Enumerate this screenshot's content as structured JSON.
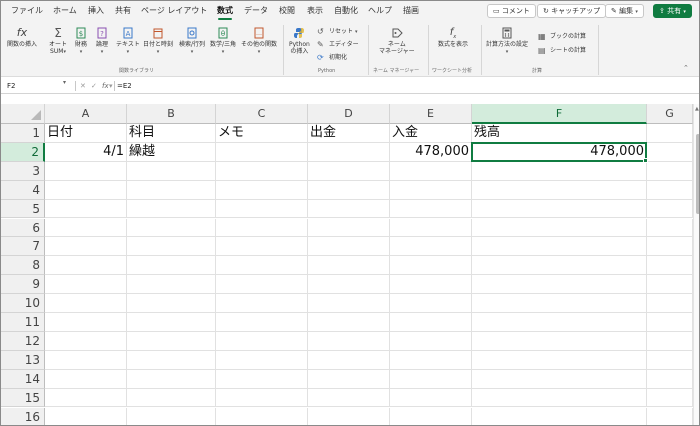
{
  "menu": {
    "tabs": [
      {
        "label": "ファイル",
        "active": false
      },
      {
        "label": "ホーム",
        "active": false
      },
      {
        "label": "挿入",
        "active": false
      },
      {
        "label": "共有",
        "active": false
      },
      {
        "label": "ページ レイアウト",
        "active": false
      },
      {
        "label": "数式",
        "active": true
      },
      {
        "label": "データ",
        "active": false
      },
      {
        "label": "校閲",
        "active": false
      },
      {
        "label": "表示",
        "active": false
      },
      {
        "label": "自動化",
        "active": false
      },
      {
        "label": "ヘルプ",
        "active": false
      },
      {
        "label": "描画",
        "active": false
      }
    ],
    "comments_label": "コメント",
    "catchup_label": "キャッチアップ",
    "edit_label": "編集",
    "share_label": "共有"
  },
  "ribbon": {
    "insert_function": "関数の挿入",
    "autosum_line1": "オート",
    "autosum_line2": "SUM",
    "financial": "財務",
    "logical": "論理",
    "text": "テキスト",
    "datetime": "日付と時刻",
    "lookup": "検索/行列",
    "math": "数学/三角",
    "more_functions": "その他の関数",
    "library_group": "関数ライブラリ",
    "python_insert_line1": "Python",
    "python_insert_line2": "の挿入",
    "reset": "リセット",
    "editor": "エディター",
    "initialize": "初期化",
    "python_group": "Python",
    "name_manager_line1": "ネーム",
    "name_manager_line2": "マネージャー",
    "name_group": "ネーム マネージャー",
    "show_formulas": "数式を表示",
    "audit_group": "ワークシート分析",
    "calc_options": "計算方法の設定",
    "calc_book": "ブックの計算",
    "calc_sheet": "シートの計算",
    "calc_group": "計算"
  },
  "formula_bar": {
    "name_box": "F2",
    "fx_label": "fx",
    "formula": "=E2"
  },
  "grid": {
    "columns": [
      "A",
      "B",
      "C",
      "D",
      "E",
      "F",
      "G"
    ],
    "selected_column": "F",
    "selected_row": 2,
    "rows": [
      "1",
      "2",
      "3",
      "4",
      "5",
      "6",
      "7",
      "8",
      "9",
      "10",
      "11",
      "12",
      "13",
      "14",
      "15",
      "16"
    ],
    "cells": {
      "A1": "日付",
      "B1": "科目",
      "C1": "メモ",
      "D1": "出金",
      "E1": "入金",
      "F1": "残高",
      "A2": "4/1",
      "B2": "繰越",
      "E2": "478,000",
      "F2": "478,000"
    }
  },
  "colors": {
    "accent": "#107c41",
    "selected_header_bg": "#d3ecdc"
  }
}
